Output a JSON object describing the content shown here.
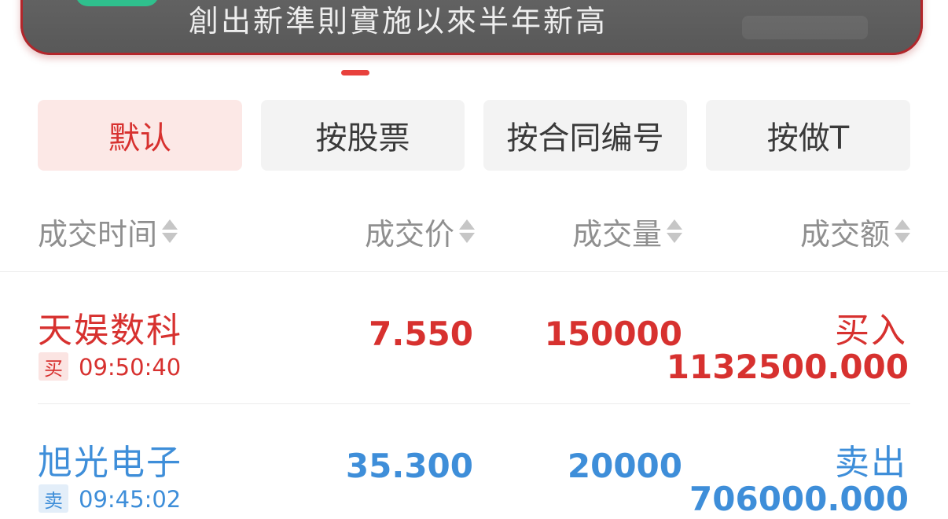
{
  "banner": {
    "headline": "創出新準則實施以來半年新高"
  },
  "filters": {
    "tabs": [
      "默认",
      "按股票",
      "按合同编号",
      "按做T"
    ],
    "active_index": 0
  },
  "columns": {
    "time": "成交时间",
    "price": "成交价",
    "volume": "成交量",
    "amount": "成交额"
  },
  "colors": {
    "buy": "#d7312f",
    "sell": "#3e8ed9",
    "accent": "#e8413d"
  },
  "trades": [
    {
      "name": "天娱数科",
      "side_badge": "买",
      "time": "09:50:40",
      "price": "7.550",
      "volume": "150000",
      "action": "买入",
      "amount": "1132500.000"
    },
    {
      "name": "旭光电子",
      "side_badge": "卖",
      "time": "09:45:02",
      "price": "35.300",
      "volume": "20000",
      "action": "卖出",
      "amount": "706000.000"
    }
  ]
}
